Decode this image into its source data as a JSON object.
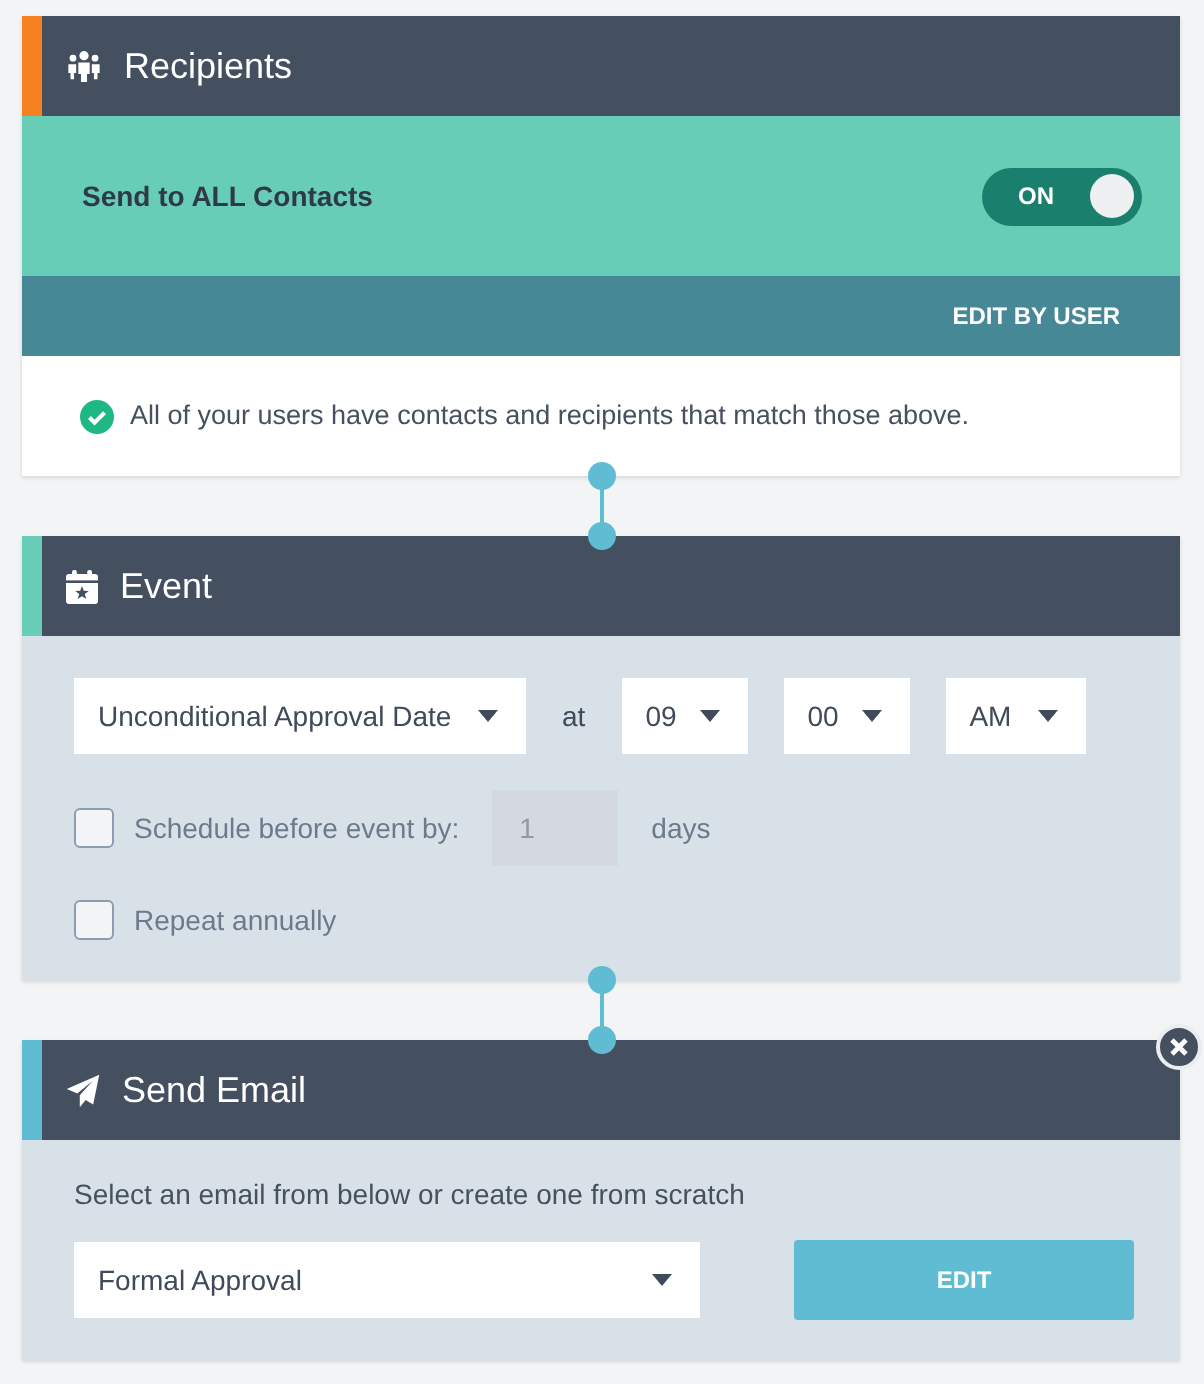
{
  "steps": [
    {
      "kind": "recipients",
      "title": "Recipients",
      "color": "#f5821f",
      "send_all": {
        "label": "Send to ALL Contacts",
        "toggle": {
          "label": "ON",
          "on": true
        }
      },
      "edit_link": "EDIT BY USER",
      "status_message": "All of your users have contacts and recipients that match those above."
    },
    {
      "kind": "event",
      "title": "Event",
      "color": "#67cdb7",
      "event_select": {
        "value": "Unconditional Approval Date"
      },
      "at_label": "at",
      "time_selects": [
        {
          "value": "09"
        },
        {
          "value": "00"
        },
        {
          "value": "AM"
        }
      ],
      "options": [
        {
          "kind": "schedule",
          "label": "Schedule before event by:",
          "checked": false,
          "input": {
            "value": "1",
            "disabled": true
          },
          "unit": "days"
        },
        {
          "kind": "plain",
          "label": "Repeat annually",
          "checked": false
        }
      ]
    },
    {
      "kind": "send_email",
      "title": "Send Email",
      "color": "#5fbcd3",
      "removable": true,
      "hint": "Select an email from below or create one from scratch",
      "email_select": {
        "value": "Formal Approval"
      },
      "edit_button": "EDIT"
    }
  ]
}
